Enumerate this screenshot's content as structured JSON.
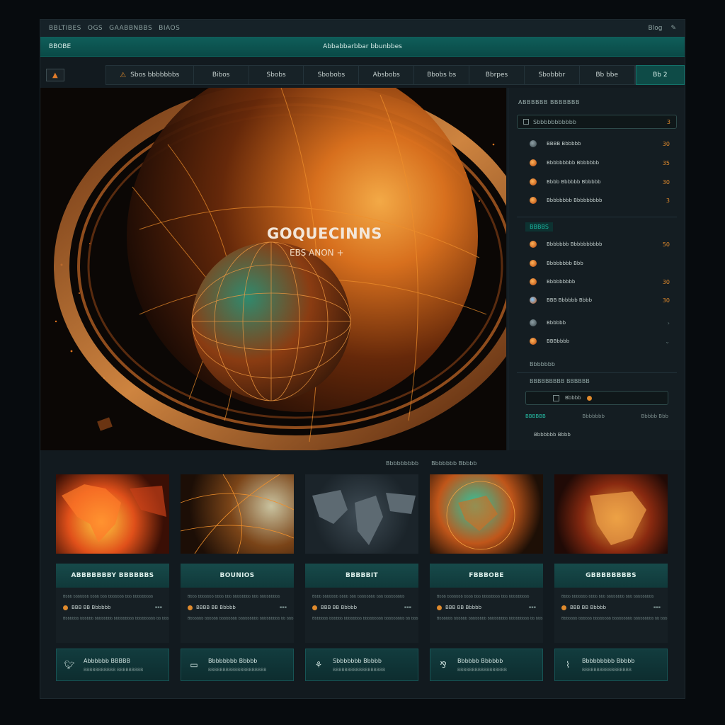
{
  "topbar": {
    "left": [
      "BBLTIBES",
      "OGS",
      "GAABBNBBS",
      "BIAOS"
    ],
    "right": [
      "Blog"
    ]
  },
  "tealbar": {
    "left": "BBOBE",
    "center": "Abbabbarbbar bbunbbes"
  },
  "nav": {
    "logo_icon": "chart-icon",
    "tabs": [
      "Sbos bbbbbbbs",
      "Bibos",
      "Sbobs",
      "Sbobobs",
      "Absbobs",
      "Bbobs bs",
      "Bbrpes",
      "Sbobbbr",
      "Bb bbe"
    ],
    "cta": "Bb 2"
  },
  "hero": {
    "title": "GOQUECINNS",
    "subtitle": "EBS ANON +"
  },
  "sidebar": {
    "title": "ABBBBBB BBBBBBB",
    "search": {
      "value": "Sbbbbbbbbbbb",
      "badge": "3"
    },
    "group1": [
      {
        "label": "BBBB Bbbbbb",
        "value": "30"
      },
      {
        "label": "Bbbbbbbbb Bbbbbbb",
        "value": "35"
      },
      {
        "label": "Bbbb Bbbbbb Bbbbbb",
        "value": "30"
      },
      {
        "label": "Bbbbbbbb Bbbbbbbbb",
        "value": "3"
      }
    ],
    "group2_title": "BBBBS",
    "group2": [
      {
        "label": "Bbbbbbb Bbbbbbbbbb",
        "value": "50"
      },
      {
        "label": "Bbbbbbbb Bbb",
        "value": ""
      },
      {
        "label": "Bbbbbbbbb",
        "value": "30"
      },
      {
        "label": "BBB Bbbbbb Bbbb",
        "value": "30"
      },
      {
        "label": "Bbbbbb",
        "value": ""
      },
      {
        "label": "BBBbbbb",
        "value": ""
      }
    ],
    "group3_title": "Bbbbbbb",
    "group3_sub": "BBBBBBBBB BBBBBB",
    "field": "Bbbbb",
    "tabs": [
      "BBBBBB",
      "Bbbbbbb",
      "Bbbbb Bbb"
    ],
    "footer": "Bbbbbbb Bbbb"
  },
  "section": {
    "labels": [
      "Bbbbbbbbb",
      "Bbbbbbb Bbbbb"
    ]
  },
  "cards": [
    {
      "title": "ABBBBBBBY BBBBBBS",
      "meta": "BBB BB Bbbbbb",
      "line1": "Bbbb bbbbbbb bbbb bbb bbbbbbb bbb bbbbbbbbb",
      "line2": "Bbbbbbb bbbbbb bbbbbbbb bbbbbbbbb bbbbbbbbb bb bbbbb",
      "footer_t1": "Abbbbbb BBBBB",
      "footer_t2": "BBBBBBBBBBB BBBBBBBBB"
    },
    {
      "title": "BOUNIOS",
      "meta": "BBBB BB Bbbbb",
      "line1": "Bbbb bbbbbbb bbbb bbb bbbbbbbb bbb bbbbbbbbb",
      "line2": "Bbbbbbb bbbbbb bbbbbbbb bbbbbbbbb bbbbbbbbb bb bbbbb",
      "footer_t1": "Bbbbbbbb Bbbbb",
      "footer_t2": "BBBBBBBBBBBBBBBBBBBB"
    },
    {
      "title": "BBBBBIT",
      "meta": "BBB BB Bbbbb",
      "line1": "Bbbb bbbbbbb bbbb bbb bbbbbbbb bbb bbbbbbbbb",
      "line2": "Bbbbbbb bbbbbb bbbbbbbb bbbbbbbbb bbbbbbbbb bb bbbbb",
      "footer_t1": "Sbbbbbbb Bbbbb",
      "footer_t2": "BBBBBBBBBBBBBBBBBB"
    },
    {
      "title": "FBBBOBE",
      "meta": "BBB BB Bbbbb",
      "line1": "Bbbb bbbbbbb bbbb bbb bbbbbbbb bbb bbbbbbbbb",
      "line2": "Bbbbbbb bbbbbb bbbbbbbb bbbbbbbbb bbbbbbbbb bb bbbbb",
      "footer_t1": "Bbbbbb Bbbbbb",
      "footer_t2": "BBBBBBBBBBBBBBBBB"
    },
    {
      "title": "GBBBBBBBBS",
      "meta": "BBB BB Bbbbb",
      "line1": "Bbbb bbbbbbb bbbb bbb bbbbbbbb bbb bbbbbbbbb",
      "line2": "Bbbbbbb bbbbbb bbbbbbbb bbbbbbbbb bbbbbbbbb bb bbbbb",
      "footer_t1": "Bbbbbbbbb Bbbbb",
      "footer_t2": "BBBBBBBBBBBBBBBBB"
    }
  ],
  "card_icons": [
    "twitter-icon",
    "image-icon",
    "plant-icon",
    "graph-icon",
    "sprout-icon"
  ],
  "colors": {
    "accent": "#e08a2c",
    "teal": "#0f5e5a",
    "bg": "#121a1f"
  }
}
